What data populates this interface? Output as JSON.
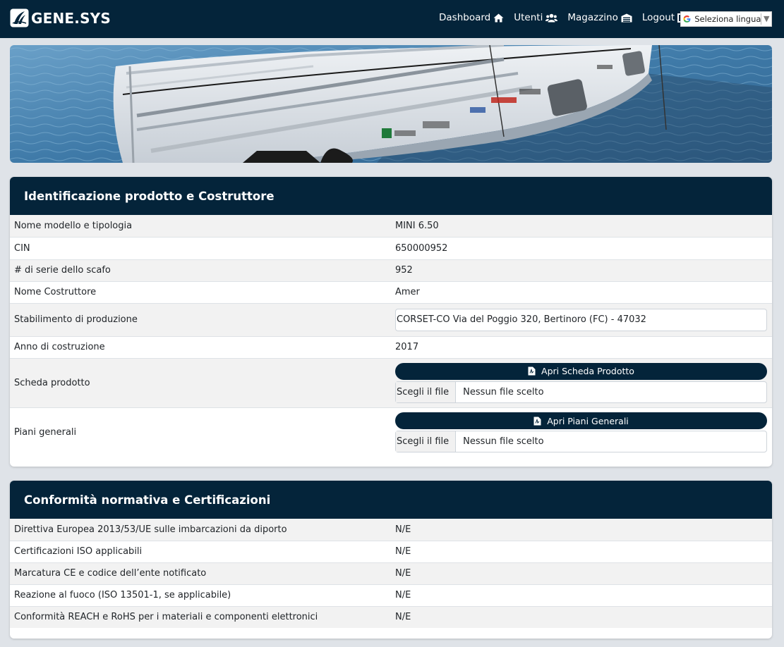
{
  "brand": {
    "name": "GENE.SYS",
    "logo_icon": "sail-logo-icon"
  },
  "nav": {
    "items": [
      {
        "label": "Dashboard",
        "icon": "home-icon"
      },
      {
        "label": "Utenti",
        "icon": "users-icon"
      },
      {
        "label": "Magazzino",
        "icon": "warehouse-icon"
      },
      {
        "label": "Logout",
        "icon": "logout-icon"
      }
    ],
    "language_selector": "Seleziona lingua"
  },
  "colors": {
    "primary": "#04243a",
    "background": "#dfe3e8",
    "row_alt": "#f2f2f2"
  },
  "section1": {
    "title": "Identificazione prodotto e Costruttore",
    "rows": [
      {
        "label": "Nome modello e tipologia",
        "value": "MINI 6.50"
      },
      {
        "label": "CIN",
        "value": "650000952"
      },
      {
        "label": "# di serie dello scafo",
        "value": "952"
      },
      {
        "label": "Nome Costruttore",
        "value": "Amer"
      },
      {
        "label": "Stabilimento di produzione",
        "value": "CORSET-CO Via del Poggio 320, Bertinoro (FC) - 47032"
      },
      {
        "label": "Anno di costruzione",
        "value": "2017"
      },
      {
        "label": "Scheda prodotto",
        "button": "Apri Scheda Prodotto",
        "file_button": "Scegli il file",
        "file_name": "Nessun file scelto"
      },
      {
        "label": "Piani generali",
        "button": "Apri Piani Generali",
        "file_button": "Scegli il file",
        "file_name": "Nessun file scelto"
      }
    ]
  },
  "section2": {
    "title": "Conformità normativa e Certificazioni",
    "rows": [
      {
        "label": "Direttiva Europea 2013/53/UE sulle imbarcazioni da diporto",
        "value": "N/E"
      },
      {
        "label": "Certificazioni ISO applicabili",
        "value": "N/E"
      },
      {
        "label": "Marcatura CE e codice dell’ente notificato",
        "value": "N/E"
      },
      {
        "label": "Reazione al fuoco (ISO 13501-1, se applicabile)",
        "value": "N/E"
      },
      {
        "label": "Conformità REACH e RoHS per i materiali e componenti elettronici",
        "value": "N/E"
      }
    ]
  }
}
